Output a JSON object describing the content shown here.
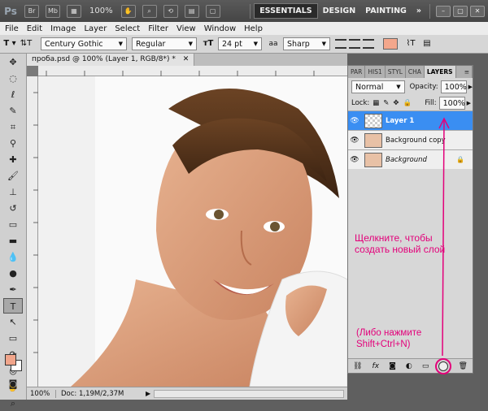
{
  "appbar": {
    "logo": "Ps",
    "icons": [
      "Br",
      "Mb"
    ],
    "zoom": "100%",
    "workspaces": [
      "ESSENTIALS",
      "DESIGN",
      "PAINTING"
    ],
    "more": "»"
  },
  "menu": [
    "File",
    "Edit",
    "Image",
    "Layer",
    "Select",
    "Filter",
    "View",
    "Window",
    "Help"
  ],
  "options": {
    "font_family": "Century Gothic",
    "font_style": "Regular",
    "font_size": "24 pt",
    "antialias": "Sharp",
    "text_color": "#f3a78c"
  },
  "document": {
    "tab_title": "проба.psd @ 100% (Layer 1, RGB/8*)",
    "tab_modified": "*",
    "ruler_h": [
      "700",
      "650",
      "600",
      "550",
      "500",
      "450",
      "400",
      "350"
    ],
    "ruler_v": [
      "0",
      "5",
      "0",
      "5",
      "0",
      "5",
      "0",
      "5",
      "0",
      "5"
    ],
    "status_zoom": "100%",
    "status_doc": "Doc: 1,19M/2,37M"
  },
  "layers_panel": {
    "tabs": [
      "PAR",
      "HIS1",
      "STYL",
      "CHA",
      "LAYERS"
    ],
    "blend_mode": "Normal",
    "opacity_label": "Opacity:",
    "opacity": "100%",
    "lock_label": "Lock:",
    "fill_label": "Fill:",
    "fill": "100%",
    "layers": [
      {
        "name": "Layer 1",
        "selected": true
      },
      {
        "name": "Background copy",
        "selected": false
      },
      {
        "name": "Background",
        "selected": false
      }
    ]
  },
  "annotations": {
    "click_text": "Щелкните, чтобы\nсоздать новый слой",
    "shortcut_text": "(Либо нажмите\nShift+Ctrl+N)"
  }
}
